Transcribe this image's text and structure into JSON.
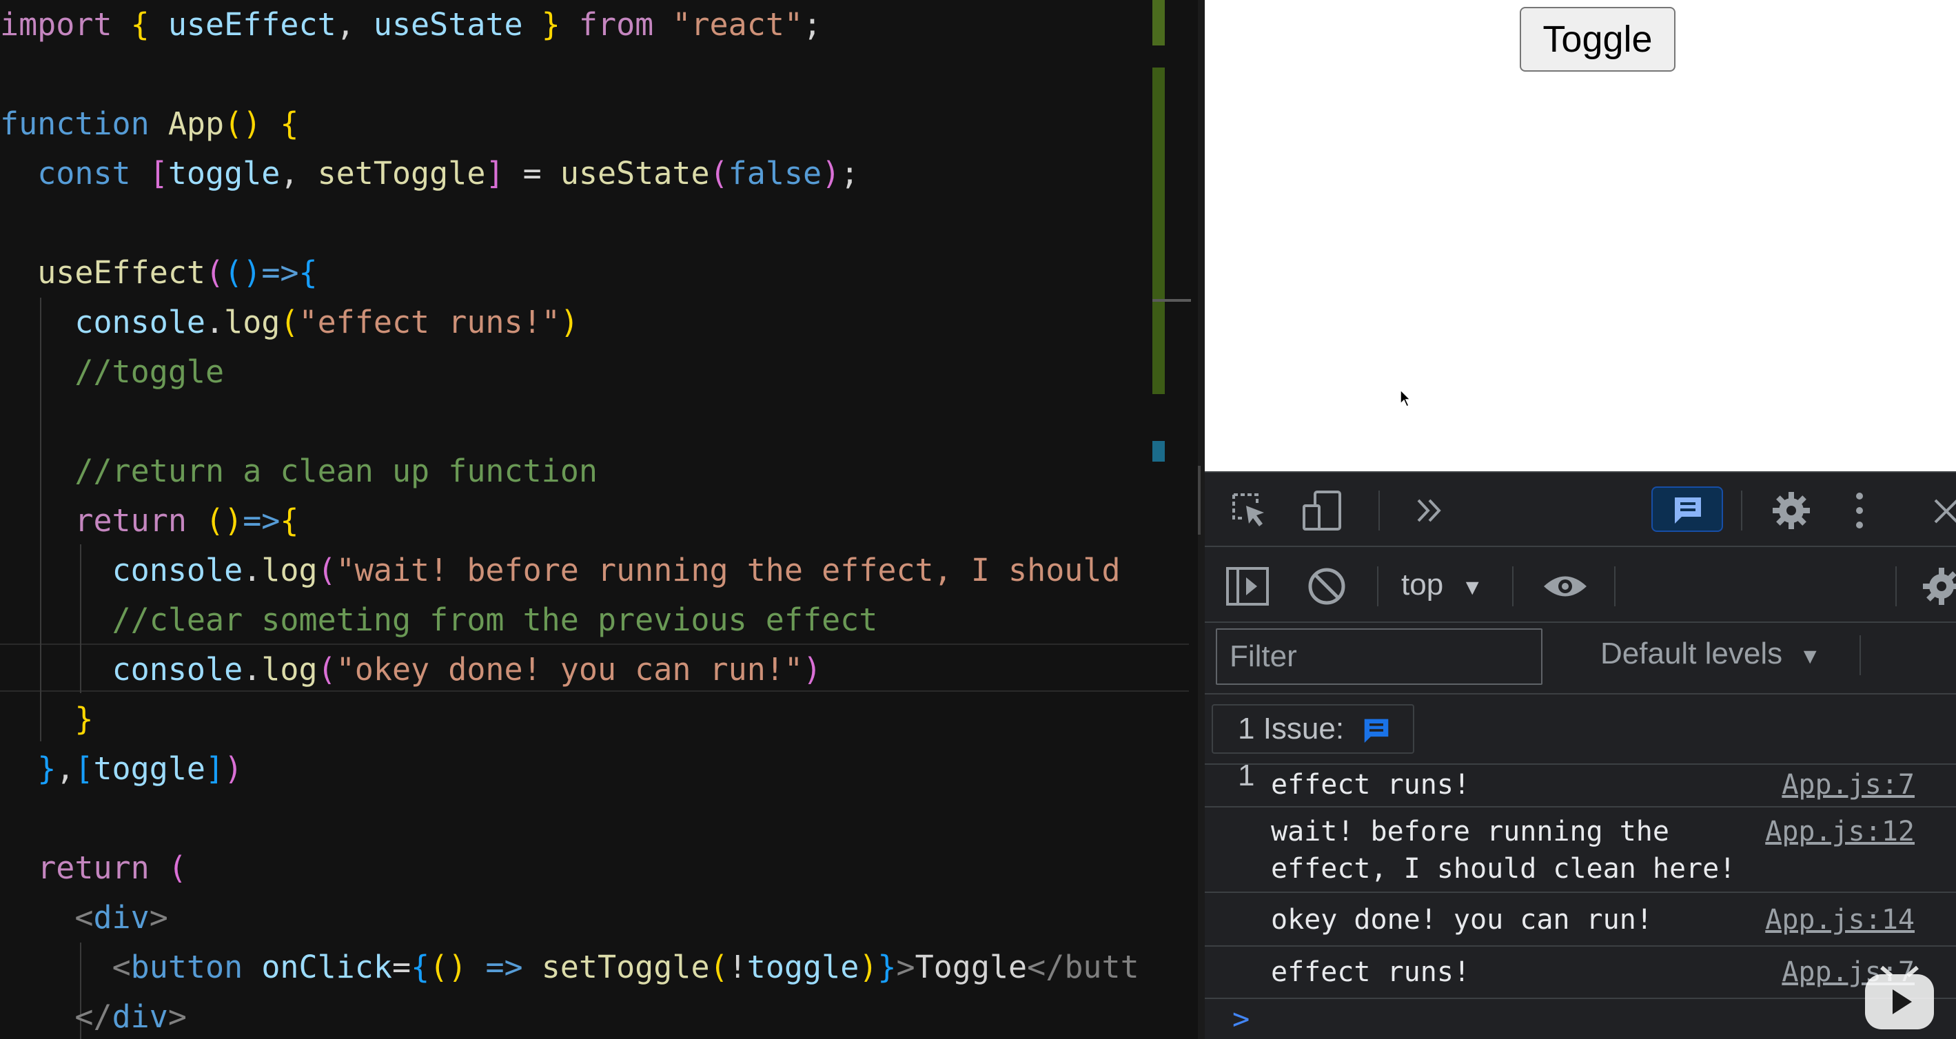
{
  "editor": {
    "lines": [
      [
        {
          "t": "import",
          "c": "kw"
        },
        {
          "t": " ",
          "c": ""
        },
        {
          "t": "{",
          "c": "b1"
        },
        {
          "t": " useEffect",
          "c": "vr"
        },
        {
          "t": ", ",
          "c": ""
        },
        {
          "t": "useState",
          "c": "vr"
        },
        {
          "t": " ",
          "c": ""
        },
        {
          "t": "}",
          "c": "b1"
        },
        {
          "t": " ",
          "c": ""
        },
        {
          "t": "from",
          "c": "kw"
        },
        {
          "t": " ",
          "c": ""
        },
        {
          "t": "\"react\"",
          "c": "str"
        },
        {
          "t": ";",
          "c": ""
        }
      ],
      [],
      [
        {
          "t": "function",
          "c": "st"
        },
        {
          "t": " ",
          "c": ""
        },
        {
          "t": "App",
          "c": "fn"
        },
        {
          "t": "()",
          "c": "b1"
        },
        {
          "t": " ",
          "c": ""
        },
        {
          "t": "{",
          "c": "b1"
        }
      ],
      [
        {
          "t": "  ",
          "c": ""
        },
        {
          "t": "const",
          "c": "st"
        },
        {
          "t": " ",
          "c": ""
        },
        {
          "t": "[",
          "c": "b2"
        },
        {
          "t": "toggle",
          "c": "vr"
        },
        {
          "t": ", ",
          "c": ""
        },
        {
          "t": "setToggle",
          "c": "fn"
        },
        {
          "t": "]",
          "c": "b2"
        },
        {
          "t": " = ",
          "c": ""
        },
        {
          "t": "useState",
          "c": "fn"
        },
        {
          "t": "(",
          "c": "b2"
        },
        {
          "t": "false",
          "c": "st"
        },
        {
          "t": ")",
          "c": "b2"
        },
        {
          "t": ";",
          "c": ""
        }
      ],
      [],
      [
        {
          "t": "  ",
          "c": ""
        },
        {
          "t": "useEffect",
          "c": "fn"
        },
        {
          "t": "(",
          "c": "b2"
        },
        {
          "t": "()",
          "c": "b3"
        },
        {
          "t": "=>",
          "c": "st"
        },
        {
          "t": "{",
          "c": "b3"
        }
      ],
      [
        {
          "t": "    ",
          "c": ""
        },
        {
          "t": "console",
          "c": "vr"
        },
        {
          "t": ".",
          "c": ""
        },
        {
          "t": "log",
          "c": "fn"
        },
        {
          "t": "(",
          "c": "b1"
        },
        {
          "t": "\"effect runs!\"",
          "c": "str"
        },
        {
          "t": ")",
          "c": "b1"
        }
      ],
      [
        {
          "t": "    ",
          "c": ""
        },
        {
          "t": "//toggle",
          "c": "cm"
        }
      ],
      [],
      [
        {
          "t": "    ",
          "c": ""
        },
        {
          "t": "//return a clean up function",
          "c": "cm"
        }
      ],
      [
        {
          "t": "    ",
          "c": ""
        },
        {
          "t": "return",
          "c": "kw"
        },
        {
          "t": " ",
          "c": ""
        },
        {
          "t": "()",
          "c": "b1"
        },
        {
          "t": "=>",
          "c": "st"
        },
        {
          "t": "{",
          "c": "b1"
        }
      ],
      [
        {
          "t": "      ",
          "c": ""
        },
        {
          "t": "console",
          "c": "vr"
        },
        {
          "t": ".",
          "c": ""
        },
        {
          "t": "log",
          "c": "fn"
        },
        {
          "t": "(",
          "c": "b2"
        },
        {
          "t": "\"wait! before running the effect, I should",
          "c": "str"
        }
      ],
      [
        {
          "t": "      ",
          "c": ""
        },
        {
          "t": "//clear someting from the previous effect",
          "c": "cm"
        }
      ],
      [
        {
          "t": "      ",
          "c": ""
        },
        {
          "t": "console",
          "c": "vr"
        },
        {
          "t": ".",
          "c": ""
        },
        {
          "t": "log",
          "c": "fn"
        },
        {
          "t": "(",
          "c": "b2"
        },
        {
          "t": "\"okey done! you can run!\"",
          "c": "str"
        },
        {
          "t": ")",
          "c": "b2"
        }
      ],
      [
        {
          "t": "    ",
          "c": ""
        },
        {
          "t": "}",
          "c": "b1"
        }
      ],
      [
        {
          "t": "  ",
          "c": ""
        },
        {
          "t": "}",
          "c": "b3"
        },
        {
          "t": ",",
          "c": ""
        },
        {
          "t": "[",
          "c": "b3"
        },
        {
          "t": "toggle",
          "c": "vr"
        },
        {
          "t": "]",
          "c": "b3"
        },
        {
          "t": ")",
          "c": "b2"
        }
      ],
      [],
      [
        {
          "t": "  ",
          "c": ""
        },
        {
          "t": "return",
          "c": "kw"
        },
        {
          "t": " ",
          "c": ""
        },
        {
          "t": "(",
          "c": "b2"
        }
      ],
      [
        {
          "t": "    ",
          "c": ""
        },
        {
          "t": "<",
          "c": "tg"
        },
        {
          "t": "div",
          "c": "tn"
        },
        {
          "t": ">",
          "c": "tg"
        }
      ],
      [
        {
          "t": "      ",
          "c": ""
        },
        {
          "t": "<",
          "c": "tg"
        },
        {
          "t": "button",
          "c": "tn"
        },
        {
          "t": " ",
          "c": ""
        },
        {
          "t": "onClick",
          "c": "vr"
        },
        {
          "t": "=",
          "c": ""
        },
        {
          "t": "{",
          "c": "b3"
        },
        {
          "t": "()",
          "c": "b1"
        },
        {
          "t": " ",
          "c": ""
        },
        {
          "t": "=>",
          "c": "st"
        },
        {
          "t": " ",
          "c": ""
        },
        {
          "t": "setToggle",
          "c": "fn"
        },
        {
          "t": "(",
          "c": "b1"
        },
        {
          "t": "!",
          "c": ""
        },
        {
          "t": "toggle",
          "c": "vr"
        },
        {
          "t": ")",
          "c": "b1"
        },
        {
          "t": "}",
          "c": "b3"
        },
        {
          "t": ">",
          "c": "tg"
        },
        {
          "t": "Toggle",
          "c": ""
        },
        {
          "t": "</butt",
          "c": "tg"
        }
      ],
      [
        {
          "t": "    ",
          "c": ""
        },
        {
          "t": "</",
          "c": "tg"
        },
        {
          "t": "div",
          "c": "tn"
        },
        {
          "t": ">",
          "c": "tg"
        }
      ]
    ]
  },
  "browser": {
    "button_label": "Toggle"
  },
  "devtools": {
    "icons": {
      "inspect": "inspect-element-icon",
      "device": "device-toolbar-icon",
      "more_tabs": "more-tabs-icon",
      "issues": "issues-icon",
      "settings": "gear-icon",
      "menu": "kebab-menu-icon",
      "close": "close-icon",
      "sidebar": "console-sidebar-icon",
      "clear": "clear-console-icon",
      "eye": "live-expression-icon",
      "console_settings": "gear-icon"
    },
    "context": "top",
    "filter_placeholder": "Filter",
    "levels": "Default levels",
    "issues_label": "1 Issue:",
    "issues_count": "1",
    "messages": [
      {
        "text": "effect runs!",
        "source": "App.js:7"
      },
      {
        "text": "wait! before running the\neffect, I should clean here!",
        "source": "App.js:12"
      },
      {
        "text": "okey done! you can run!",
        "source": "App.js:14"
      },
      {
        "text": "effect runs!",
        "source": "App.js:7"
      }
    ],
    "prompt": ">",
    "colors": {
      "accent": "#8ab4f8",
      "issues_bg": "#0c2f51",
      "panel_bg": "#202124"
    }
  }
}
